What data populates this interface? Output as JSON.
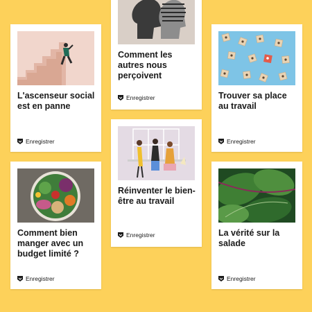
{
  "accent_colors": {
    "background": "#fdd15a",
    "card": "#ffffff",
    "text": "#1a1a1a"
  },
  "save_icon": "bookmark-icon",
  "cards": [
    {
      "title": "L'ascenseur social est en panne",
      "save_label": "Enregistrer"
    },
    {
      "title": "Comment les autres nous perçoivent",
      "save_label": "Enregistrer"
    },
    {
      "title": "Trouver sa place au travail",
      "save_label": "Enregistrer"
    },
    {
      "title": "Comment bien manger avec un budget limité ?",
      "save_label": "Enregistrer"
    },
    {
      "title": "Réinventer le bien-être au travail",
      "save_label": "Enregistrer"
    },
    {
      "title": "La vérité sur la salade",
      "save_label": "Enregistrer"
    }
  ]
}
